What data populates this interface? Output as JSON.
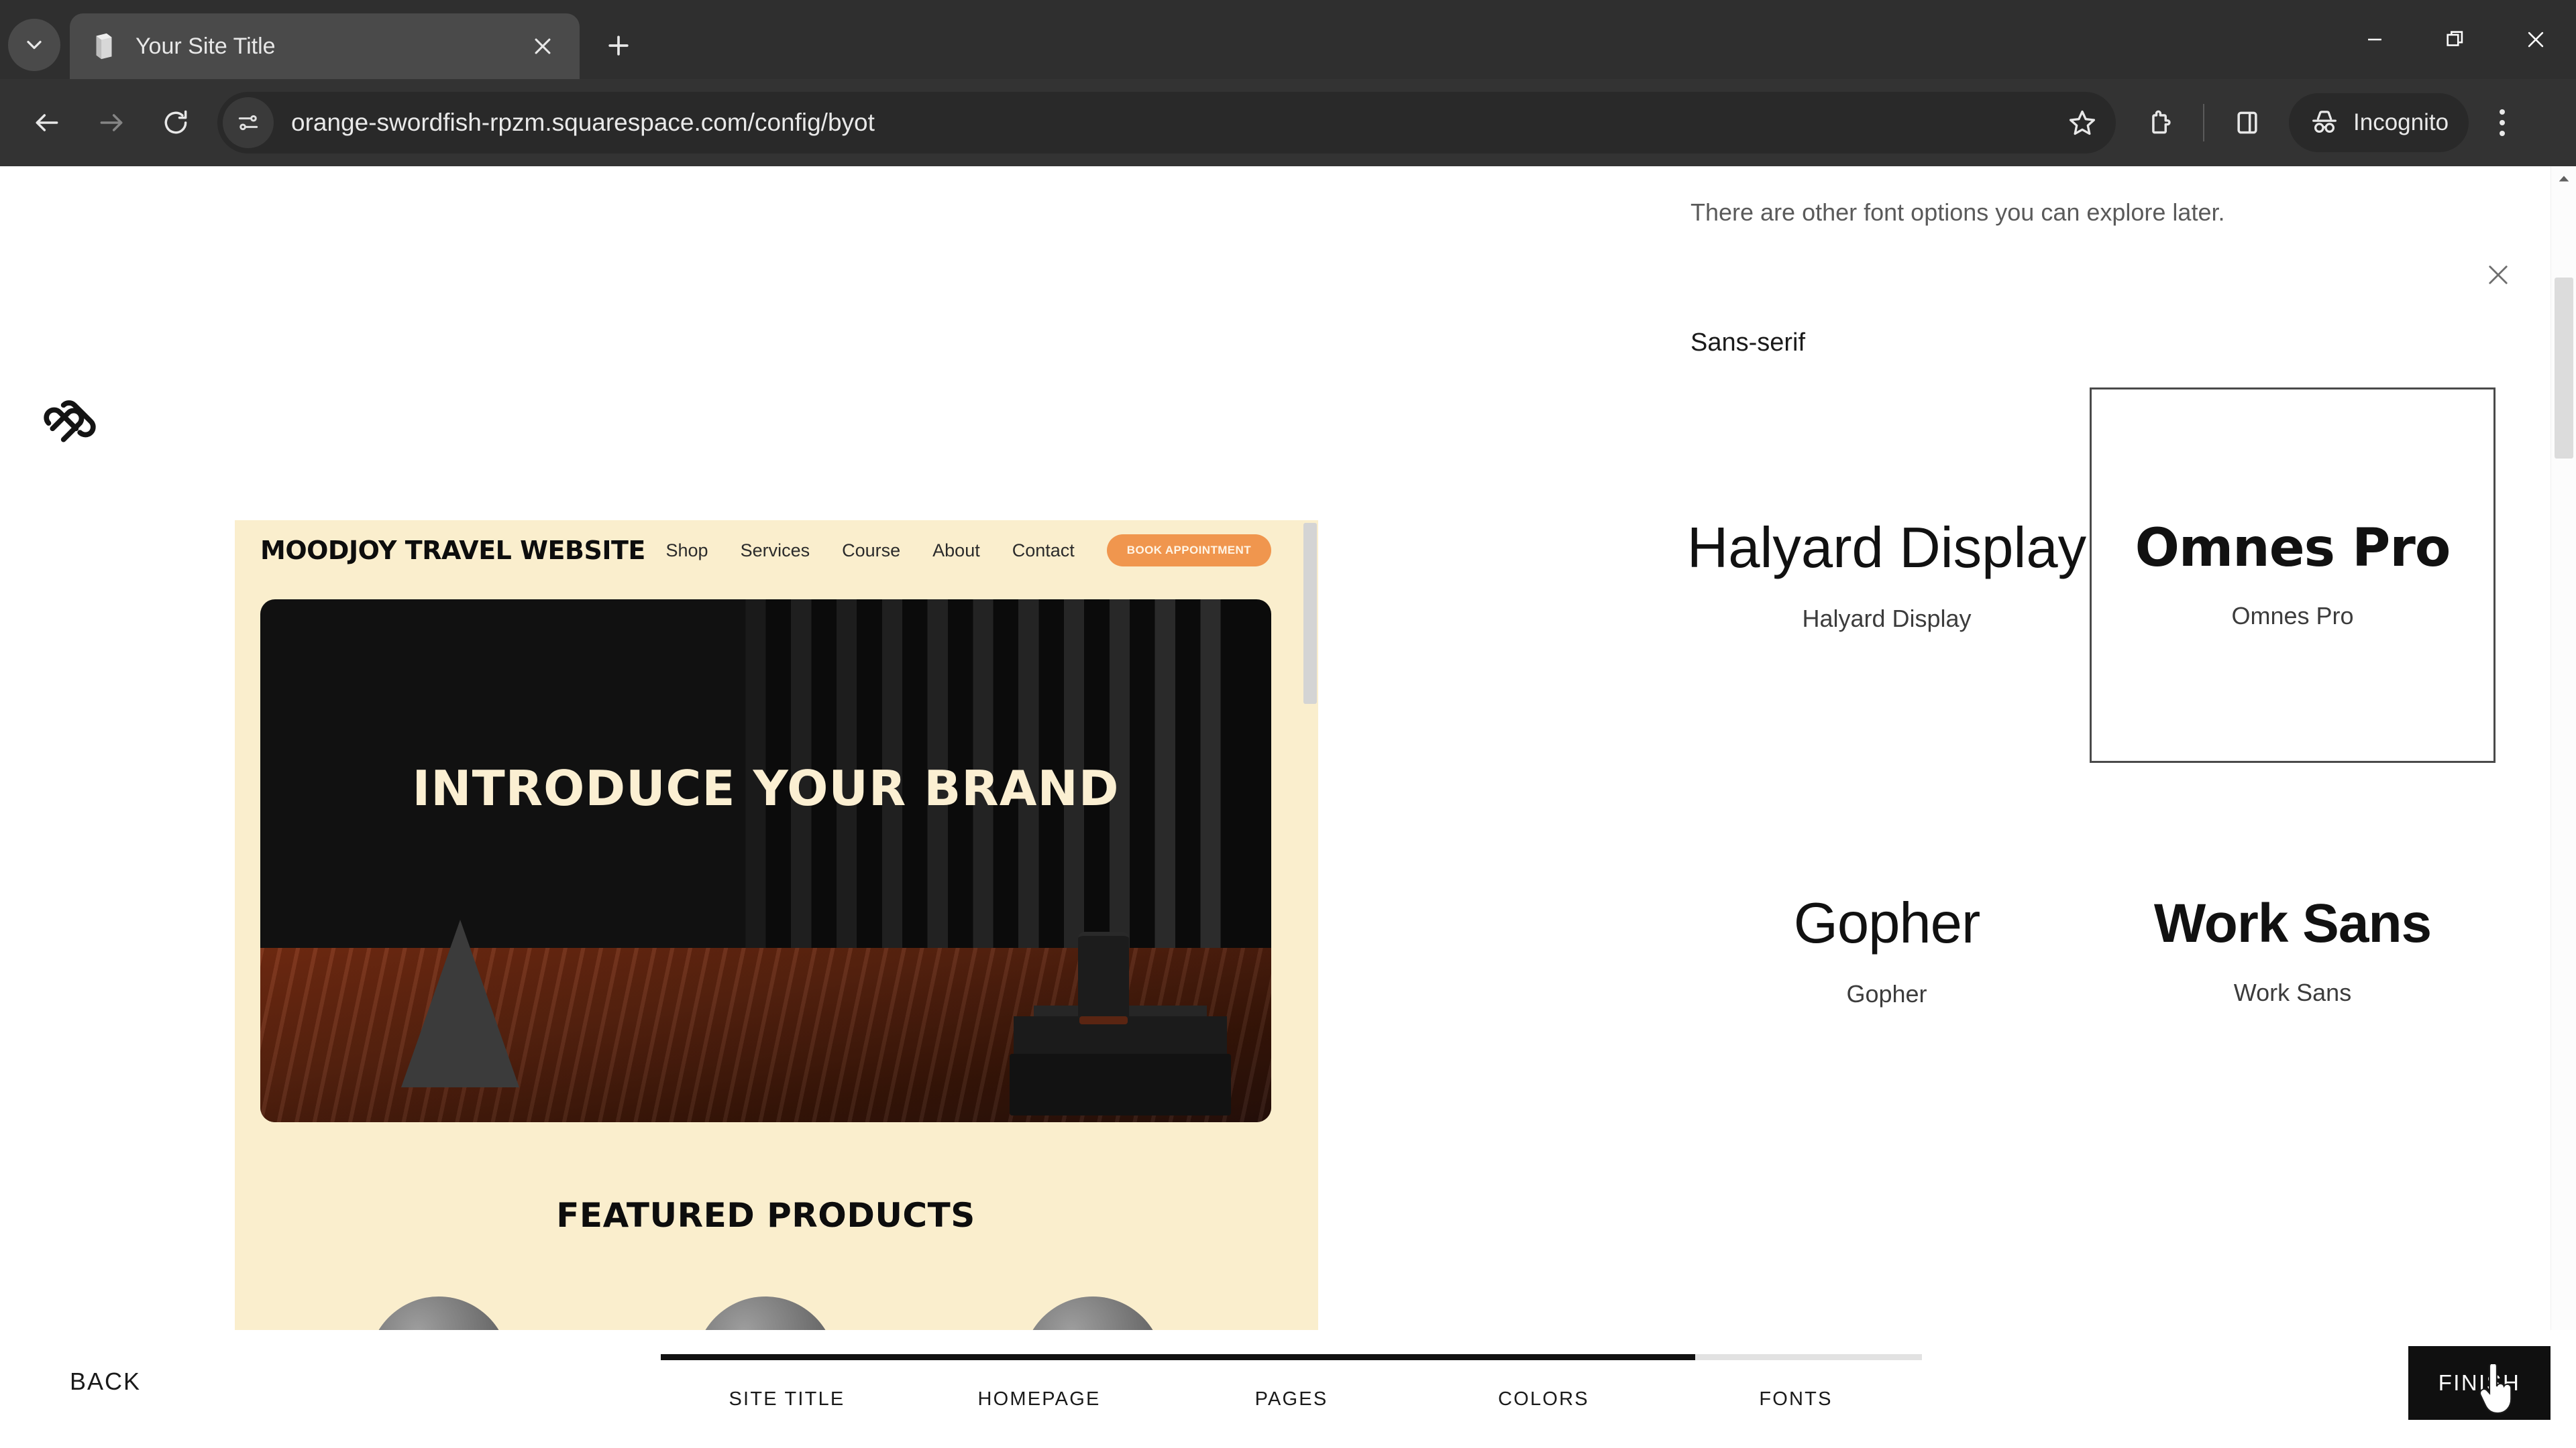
{
  "browser": {
    "tab": {
      "title": "Your Site Title",
      "favicon_icon": "page-icon",
      "close_icon": "close-icon"
    },
    "tab_search_icon": "chevron-down-icon",
    "new_tab_icon": "plus-icon",
    "window_controls": {
      "minimize_icon": "minimize-icon",
      "maximize_icon": "restore-icon",
      "close_icon": "close-icon"
    },
    "nav": {
      "back_icon": "arrow-left-icon",
      "forward_icon": "arrow-right-icon",
      "reload_icon": "reload-icon"
    },
    "omnibox": {
      "site_info_icon": "site-settings-icon",
      "url": "orange-swordfish-rpzm.squarespace.com/config/byot",
      "bookmark_icon": "star-icon"
    },
    "extensions_icon": "extensions-icon",
    "side_panel_icon": "side-panel-icon",
    "incognito": {
      "label": "Incognito",
      "icon": "incognito-icon"
    },
    "menu_icon": "kebab-menu-icon"
  },
  "app": {
    "logo_icon": "squarespace-logo-icon"
  },
  "preview": {
    "brand": "MOODJOY TRAVEL WEBSITE",
    "nav": [
      "Shop",
      "Services",
      "Course",
      "About",
      "Contact"
    ],
    "cta": "BOOK APPOINTMENT",
    "hero_title": "INTRODUCE YOUR BRAND",
    "featured_heading": "FEATURED PRODUCTS",
    "scrollbar_name": "preview-scrollbar"
  },
  "panel": {
    "note": "There are other font options you can explore later.",
    "close_icon": "close-icon",
    "section_title": "Sans-serif",
    "fonts": [
      {
        "sample": "Halyard Display",
        "name": "Halyard Display",
        "selected": false
      },
      {
        "sample": "Omnes Pro",
        "name": "Omnes Pro",
        "selected": true
      },
      {
        "sample": "Gopher",
        "name": "Gopher",
        "selected": false
      },
      {
        "sample": "Work Sans",
        "name": "Work Sans",
        "selected": false
      }
    ]
  },
  "footer": {
    "back_label": "BACK",
    "steps": [
      "SITE TITLE",
      "HOMEPAGE",
      "PAGES",
      "COLORS",
      "FONTS"
    ],
    "progress_percent": 82,
    "finish_label": "FINISH"
  },
  "colors": {
    "chrome_bg": "#333333",
    "tabstrip_bg": "#2f2f2f",
    "preview_cream": "#faeecd",
    "preview_accent_orange": "#f0964e",
    "accent_black": "#101010"
  }
}
